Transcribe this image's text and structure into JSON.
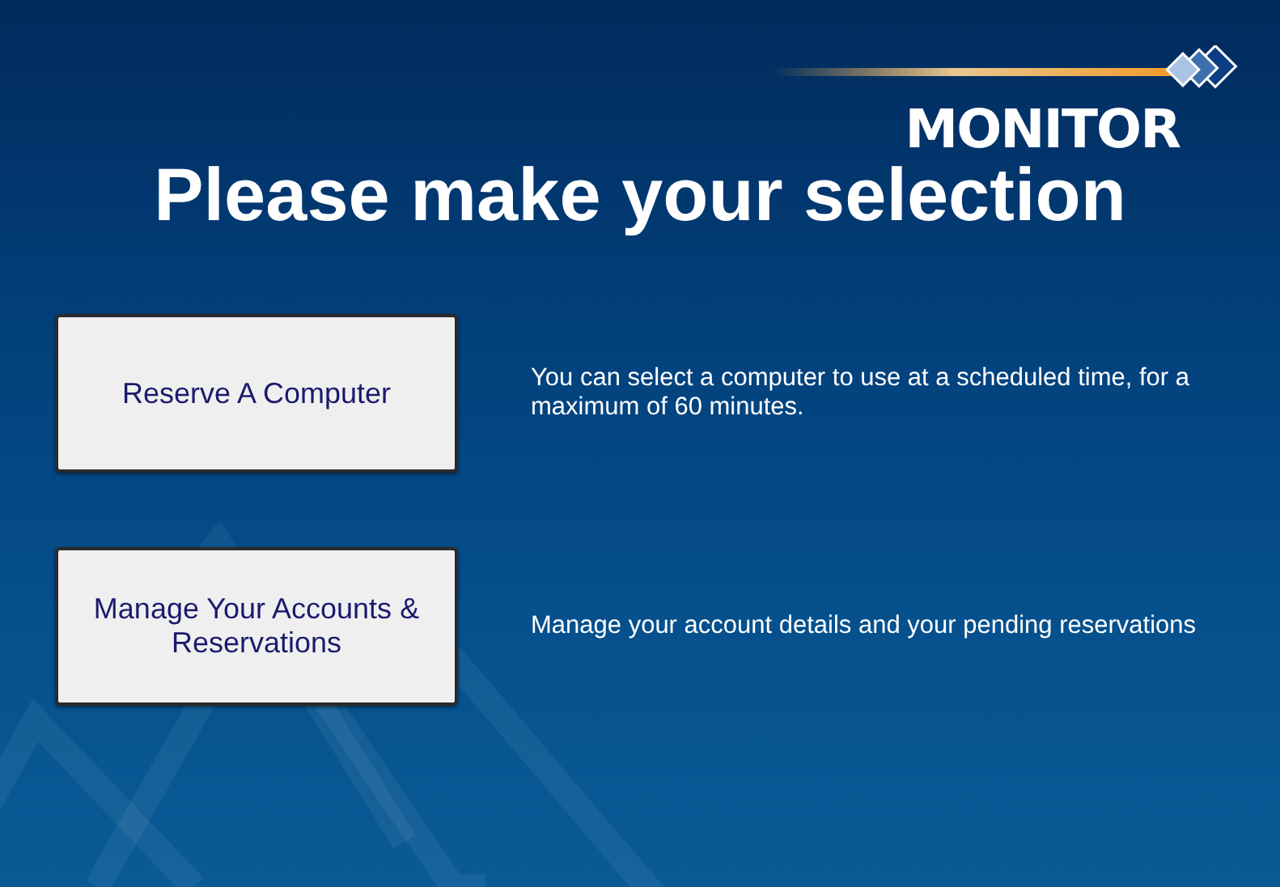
{
  "logo": {
    "text": "MONITOR"
  },
  "heading": "Please make your selection",
  "options": [
    {
      "label": "Reserve A Computer",
      "description": "You can select a computer to use at a scheduled time, for a maximum of 60 minutes."
    },
    {
      "label": "Manage Your Accounts & Reservations",
      "description": "Manage your account details and your pending reservations"
    }
  ]
}
